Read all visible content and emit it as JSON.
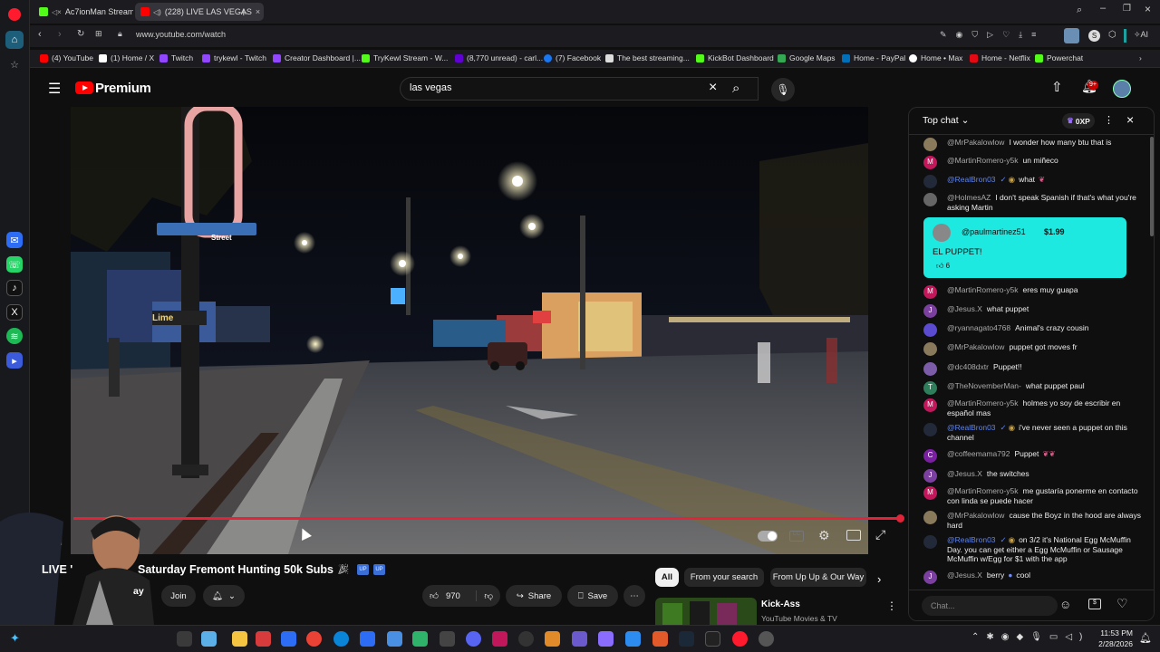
{
  "browser": {
    "tabs": [
      {
        "label": "Ac7ionMan Stream - V"
      },
      {
        "label": "(228) LIVE LAS VEGAS"
      }
    ],
    "url": "www.youtube.com/watch",
    "ai_label": "AI",
    "bookmarks": [
      {
        "label": "(4) YouTube",
        "color": "#ff0000"
      },
      {
        "label": "(1) Home / X",
        "color": "#ffffff"
      },
      {
        "label": "Twitch",
        "color": "#9146ff"
      },
      {
        "label": "trykewl - Twitch",
        "color": "#9146ff"
      },
      {
        "label": "Creator Dashboard |...",
        "color": "#9146ff"
      },
      {
        "label": "TryKewl Stream - W...",
        "color": "#53fc18"
      },
      {
        "label": "(8,770 unread) - carl...",
        "color": "#6001d2"
      },
      {
        "label": "(7) Facebook",
        "color": "#1877f2"
      },
      {
        "label": "The best streaming...",
        "color": "#dddddd"
      },
      {
        "label": "KickBot Dashboard",
        "color": "#53fc18"
      },
      {
        "label": "Google Maps",
        "color": "#34a853"
      },
      {
        "label": "Home - PayPal",
        "color": "#0070ba"
      },
      {
        "label": "Home • Max",
        "color": "#ffffff"
      },
      {
        "label": "Home - Netflix",
        "color": "#e50914"
      },
      {
        "label": "Powerchat",
        "color": "#53fc18"
      }
    ]
  },
  "youtube": {
    "logo_text": "Premium",
    "search_value": "las vegas",
    "notification_badge": "9+"
  },
  "video": {
    "title": "LIVE LAS VEGAS Saturday Fremont Hunting 50k Subs",
    "title_prefix_visible": "LIVE '",
    "title_visible": "Saturday Fremont Hunting 50k Subs",
    "channel_fragment": "ay",
    "join_label": "Join",
    "like_count": "970",
    "share_label": "Share",
    "save_label": "Save",
    "street_sign": "Street"
  },
  "recommendations": {
    "chips": [
      "All",
      "From your search",
      "From Up Up & Our Way"
    ],
    "first": {
      "title": "Kick-Ass",
      "subtitle": "YouTube Movies & TV"
    }
  },
  "chat": {
    "header": "Top chat",
    "points_label": "0XP",
    "input_placeholder": "Chat...",
    "superchat": {
      "author": "@paulmartinez51",
      "amount": "$1.99",
      "message": "EL PUPPET!",
      "likes": "6"
    },
    "messages": [
      {
        "author": "@MrPakalowlow",
        "text": "I wonder how many btu that is",
        "initial": "",
        "color": "#8a7a5c"
      },
      {
        "author": "@MartinRomero-y5k",
        "text": "un miñeco",
        "initial": "M",
        "color": "#c2185b"
      },
      {
        "author": "@RealBron03",
        "text": "what",
        "initial": "",
        "color": "#222a3a",
        "mod": true
      },
      {
        "author": "@HolmesAZ",
        "text": "I don't speak Spanish if that's what you're asking Martin",
        "initial": "",
        "color": "#666666"
      },
      {
        "author": "@MartinRomero-y5k",
        "text": "eres muy guapa",
        "initial": "M",
        "color": "#c2185b"
      },
      {
        "author": "@Jesus.X",
        "text": "what puppet",
        "initial": "J",
        "color": "#7b3fa0"
      },
      {
        "author": "@ryannagato4768",
        "text": "Animal's crazy cousin",
        "initial": "",
        "color": "#5b4bd1"
      },
      {
        "author": "@MrPakalowlow",
        "text": "puppet got moves fr",
        "initial": "",
        "color": "#8a7a5c"
      },
      {
        "author": "@dc408dxtr",
        "text": "Puppet!!",
        "initial": "",
        "color": "#7c5ca8"
      },
      {
        "author": "@TheNovemberMan-",
        "text": "what puppet paul",
        "initial": "T",
        "color": "#2e7d5b"
      },
      {
        "author": "@MartinRomero-y5k",
        "text": "holmes yo soy de escribir en español mas",
        "initial": "M",
        "color": "#c2185b"
      },
      {
        "author": "@RealBron03",
        "text": "i've never seen a puppet on this channel",
        "initial": "",
        "color": "#222a3a",
        "mod": true
      },
      {
        "author": "@coffeemama792",
        "text": "Puppet",
        "initial": "C",
        "color": "#7b1fa2"
      },
      {
        "author": "@Jesus.X",
        "text": "the switches",
        "initial": "J",
        "color": "#7b3fa0"
      },
      {
        "author": "@MartinRomero-y5k",
        "text": "me gustaría ponerme en contacto con linda se puede hacer",
        "initial": "M",
        "color": "#c2185b"
      },
      {
        "author": "@MrPakalowlow",
        "text": "cause the Boyz in the hood are always hard",
        "initial": "",
        "color": "#8a7a5c"
      },
      {
        "author": "@RealBron03",
        "text": "on 3/2 it's National Egg McMuffin Day. you can get either a Egg McMuffin or Sausage McMuffin w/Egg for $1 with the app",
        "initial": "",
        "color": "#222a3a",
        "mod": true
      },
      {
        "author": "@Jesus.X",
        "text": "berry",
        "initial": "J",
        "color": "#7b3fa0"
      },
      {
        "author": "",
        "text": "cool",
        "initial": "",
        "color": "#000000"
      }
    ]
  },
  "taskbar": {
    "time": "11:53 PM",
    "date": "2/28/2026"
  }
}
